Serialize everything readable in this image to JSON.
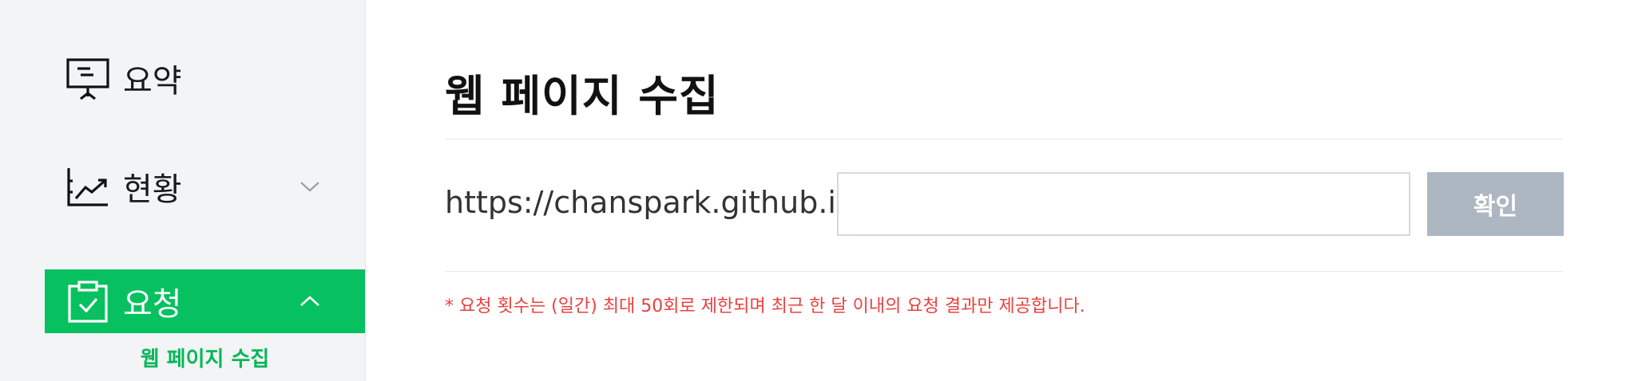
{
  "sidebar": {
    "items": [
      {
        "label": "요약",
        "icon": "presentation-board-icon"
      },
      {
        "label": "현황",
        "icon": "trend-chart-icon",
        "chevron": "chevron-down-icon"
      },
      {
        "label": "요청",
        "icon": "clipboard-check-icon",
        "chevron": "chevron-up-icon",
        "active": true
      }
    ],
    "sub_items": [
      {
        "label": "웹 페이지 수집",
        "active": true
      }
    ],
    "active_color": "#07c160"
  },
  "main": {
    "title": "웹 페이지 수집",
    "url_prefix": "https://chanspark.github.io/",
    "url_input_value": "",
    "confirm_label": "확인",
    "notice": "* 요청 횟수는 (일간) 최대 50회로 제한되며 최근 한 달 이내의 요청 결과만 제공합니다."
  },
  "colors": {
    "sidebar_bg": "#f3f4f6",
    "button_bg": "#adb7c2",
    "notice": "#e8413e",
    "sub_item": "#07b659"
  }
}
